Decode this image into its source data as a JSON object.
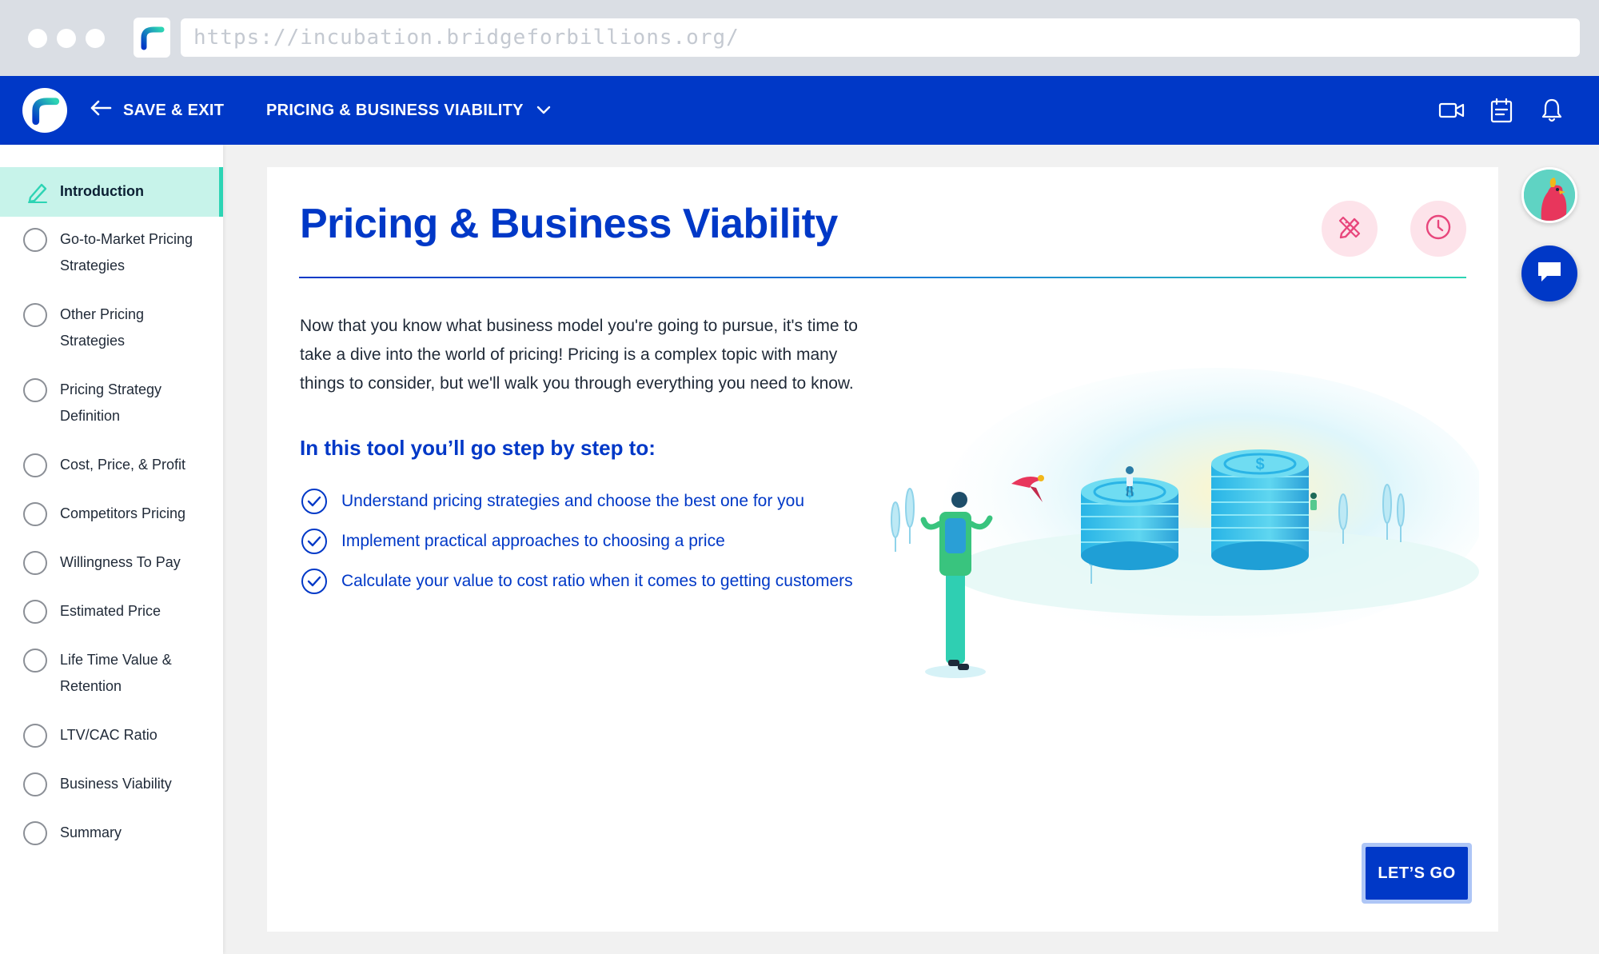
{
  "browser": {
    "url": "https://incubation.bridgeforbillions.org/"
  },
  "header": {
    "save_exit_label": "SAVE & EXIT",
    "tool_title": "PRICING & BUSINESS VIABILITY",
    "icons": [
      "video-icon",
      "calendar-icon",
      "bell-icon"
    ]
  },
  "sidebar": {
    "items": [
      {
        "label": "Introduction",
        "active": true
      },
      {
        "label": "Go-to-Market Pricing Strategies"
      },
      {
        "label": "Other Pricing Strategies"
      },
      {
        "label": "Pricing Strategy Definition"
      },
      {
        "label": "Cost, Price, & Profit"
      },
      {
        "label": "Competitors Pricing"
      },
      {
        "label": "Willingness To Pay"
      },
      {
        "label": "Estimated Price"
      },
      {
        "label": "Life Time Value & Retention"
      },
      {
        "label": "LTV/CAC Ratio"
      },
      {
        "label": "Business Viability"
      },
      {
        "label": "Summary"
      }
    ]
  },
  "main": {
    "title": "Pricing & Business Viability",
    "intro": "Now that you know what business model you're going to pursue, it's time to take a dive into the world of pricing! Pricing is a complex topic with many things to consider, but we'll walk you through everything you need to know.",
    "steps_heading": "In this tool you’ll go step by step to:",
    "steps": [
      "Understand pricing strategies and choose the best one for you",
      "Implement practical approaches to choosing a price",
      "Calculate your value to cost ratio when it comes to getting customers"
    ],
    "cta_label": "LET’S GO"
  },
  "colors": {
    "brand_blue": "#0038c7",
    "active_bg": "#c7f3ea",
    "accent_teal": "#2dd4b4",
    "pink_soft": "#fde3ea",
    "pink_icon": "#e8467c"
  }
}
